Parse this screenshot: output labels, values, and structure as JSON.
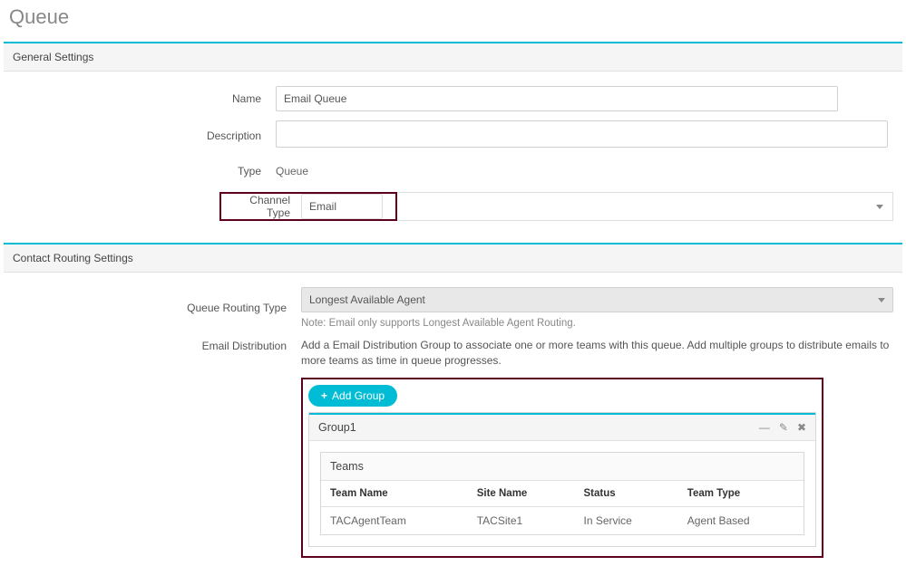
{
  "page_title": "Queue",
  "sections": {
    "general": {
      "title": "General Settings",
      "name_label": "Name",
      "name_value": "Email Queue",
      "description_label": "Description",
      "description_value": "",
      "type_label": "Type",
      "type_value": "Queue",
      "channel_type_label": "Channel Type",
      "channel_type_value": "Email"
    },
    "routing": {
      "title": "Contact Routing Settings",
      "queue_routing_type_label": "Queue Routing Type",
      "queue_routing_type_value": "Longest Available Agent",
      "queue_routing_note": "Note: Email only supports Longest Available Agent Routing.",
      "email_distribution_label": "Email Distribution",
      "email_distribution_desc": "Add a Email Distribution Group to associate one or more teams with this queue. Add multiple groups to distribute emails to more teams as time in queue progresses.",
      "add_group_label": "Add Group",
      "group": {
        "title": "Group1",
        "teams_title": "Teams",
        "columns": {
          "team_name": "Team Name",
          "site_name": "Site Name",
          "status": "Status",
          "team_type": "Team Type"
        },
        "rows": [
          {
            "team_name": "TACAgentTeam",
            "site_name": "TACSite1",
            "status": "In Service",
            "team_type": "Agent Based"
          }
        ]
      }
    }
  }
}
